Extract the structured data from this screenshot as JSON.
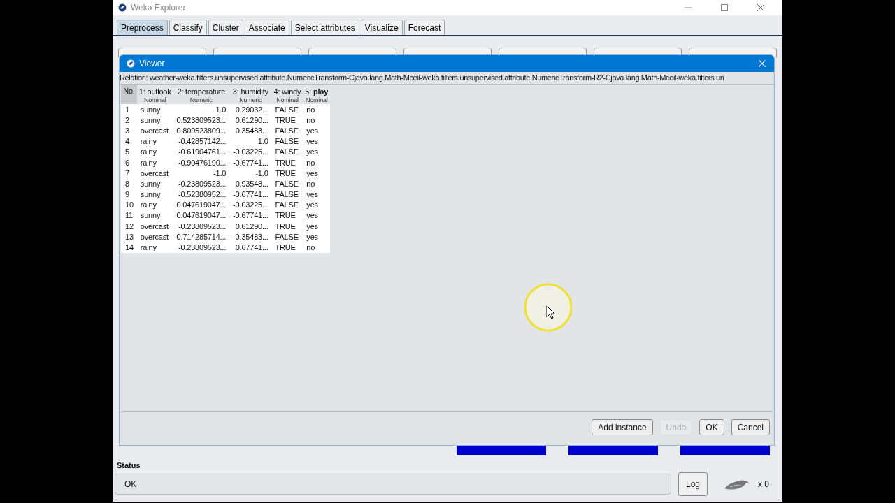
{
  "window": {
    "title": "Weka Explorer"
  },
  "tabs": [
    {
      "label": "Preprocess",
      "selected": true
    },
    {
      "label": "Classify",
      "selected": false
    },
    {
      "label": "Cluster",
      "selected": false
    },
    {
      "label": "Associate",
      "selected": false
    },
    {
      "label": "Select attributes",
      "selected": false
    },
    {
      "label": "Visualize",
      "selected": false
    },
    {
      "label": "Forecast",
      "selected": false
    }
  ],
  "viewer": {
    "title": "Viewer",
    "relation": "Relation: weather-weka.filters.unsupervised.attribute.NumericTransform-Cjava.lang.Math-Mceil-weka.filters.unsupervised.attribute.NumericTransform-R2-Cjava.lang.Math-Mceil-weka.filters.un",
    "table": {
      "columns": [
        {
          "name": "No.",
          "kind": "index"
        },
        {
          "name": "1: outlook",
          "type": "Nominal",
          "kind": "nominal"
        },
        {
          "name": "2: temperature",
          "type": "Numeric",
          "kind": "numeric"
        },
        {
          "name": "3: humidity",
          "type": "Numeric",
          "kind": "numeric"
        },
        {
          "name": "4: windy",
          "type": "Nominal",
          "kind": "nominal"
        },
        {
          "name": "5: **play**",
          "type": "Nominal",
          "kind": "nominal"
        }
      ],
      "rows": [
        [
          "1",
          "sunny",
          "1.0",
          "0.29032...",
          "FALSE",
          "no"
        ],
        [
          "2",
          "sunny",
          "0.523809523...",
          "0.61290...",
          "TRUE",
          "no"
        ],
        [
          "3",
          "overcast",
          "0.809523809...",
          "0.35483...",
          "FALSE",
          "yes"
        ],
        [
          "4",
          "rainy",
          "-0.42857142...",
          "1.0",
          "FALSE",
          "yes"
        ],
        [
          "5",
          "rainy",
          "-0.61904761...",
          "-0.03225...",
          "FALSE",
          "yes"
        ],
        [
          "6",
          "rainy",
          "-0.90476190...",
          "-0.67741...",
          "TRUE",
          "no"
        ],
        [
          "7",
          "overcast",
          "-1.0",
          "-1.0",
          "TRUE",
          "yes"
        ],
        [
          "8",
          "sunny",
          "-0.23809523...",
          "0.93548...",
          "FALSE",
          "no"
        ],
        [
          "9",
          "sunny",
          "-0.52380952...",
          "-0.67741...",
          "FALSE",
          "yes"
        ],
        [
          "10",
          "rainy",
          "0.047619047...",
          "-0.03225...",
          "FALSE",
          "yes"
        ],
        [
          "11",
          "sunny",
          "0.047619047...",
          "-0.67741...",
          "TRUE",
          "yes"
        ],
        [
          "12",
          "overcast",
          "-0.23809523...",
          "0.61290...",
          "TRUE",
          "yes"
        ],
        [
          "13",
          "overcast",
          "0.714285714...",
          "-0.35483...",
          "FALSE",
          "yes"
        ],
        [
          "14",
          "rainy",
          "-0.23809523...",
          "0.67741...",
          "TRUE",
          "no"
        ]
      ]
    },
    "buttons": [
      {
        "label": "Add instance",
        "disabled": false
      },
      {
        "label": "Undo",
        "disabled": true
      },
      {
        "label": "OK",
        "disabled": false
      },
      {
        "label": "Cancel",
        "disabled": false
      }
    ]
  },
  "status": {
    "label": "Status",
    "message": "OK"
  },
  "log_button": "Log",
  "task_count": "x 0"
}
